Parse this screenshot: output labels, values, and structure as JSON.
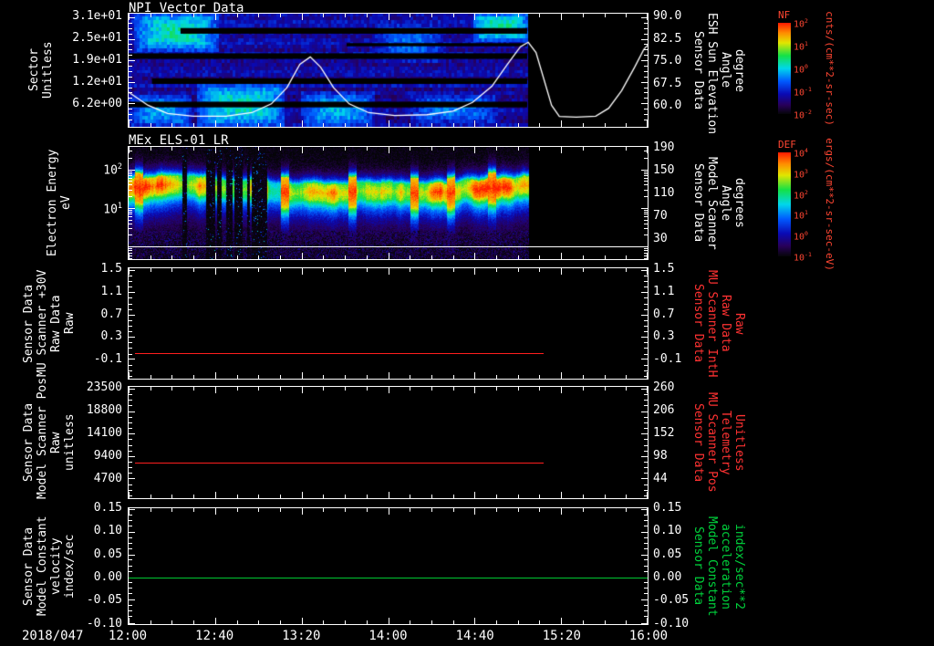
{
  "window_bg": "#000000",
  "date_label": "2018/047",
  "x_axis": {
    "tick_labels": [
      "12:00",
      "12:40",
      "13:20",
      "14:00",
      "14:40",
      "15:20",
      "16:00"
    ]
  },
  "colorbar_gradient": [
    [
      "#050508",
      0
    ],
    [
      "#28005a",
      0.1
    ],
    [
      "#0a0ab4",
      0.22
    ],
    [
      "#005aff",
      0.36
    ],
    [
      "#00d7eb",
      0.5
    ],
    [
      "#14e146",
      0.64
    ],
    [
      "#e1e600",
      0.78
    ],
    [
      "#ff8c00",
      0.89
    ],
    [
      "#ff1900",
      1
    ]
  ],
  "colorbars": [
    {
      "title": "NF",
      "tick_labels": [
        "10^2",
        "10^1",
        "10^0",
        "10^-1",
        "10^-2"
      ],
      "unit": "cnts/(cm**2-sr-sec)",
      "color": "#ff4632"
    },
    {
      "title": "DEF",
      "tick_labels": [
        "10^4",
        "10^3",
        "10^2",
        "10^1",
        "10^0",
        "10^-1"
      ],
      "unit": "ergs/(cm**2-sr-sec-eV)",
      "color": "#ff4632"
    }
  ],
  "chart_data": [
    {
      "type": "heatmap",
      "title": "NPI Vector Data",
      "left_label_lines": [
        "Sector",
        "Unitless"
      ],
      "left_ticks": [
        {
          "label": "3.1e+01",
          "pos": 0.032
        },
        {
          "label": "2.5e+01",
          "pos": 0.222
        },
        {
          "label": "1.9e+01",
          "pos": 0.413
        },
        {
          "label": "1.2e+01",
          "pos": 0.603
        },
        {
          "label": "6.2e+00",
          "pos": 0.794
        }
      ],
      "right_label_lines": [
        "Sensor Data",
        "ESH Sun Elevation",
        "Angle",
        "degree"
      ],
      "right_label_color": "#ffffff",
      "right_ticks": [
        {
          "label": "90.0",
          "pos": 0.032,
          "value": 90
        },
        {
          "label": "82.5",
          "pos": 0.227,
          "value": 82.5
        },
        {
          "label": "75.0",
          "pos": 0.421,
          "value": 75
        },
        {
          "label": "67.5",
          "pos": 0.616,
          "value": 67.5
        },
        {
          "label": "60.0",
          "pos": 0.81,
          "value": 60
        }
      ],
      "x_span_hours": [
        0,
        4
      ],
      "data_end_frac": 0.768,
      "units": "cnts/(cm**2-sr-sec)",
      "overlay_line": {
        "name": "ESH Sun Elevation Angle",
        "color": "#ffffff",
        "units": "degree",
        "points_time_value": [
          [
            0,
            64.5
          ],
          [
            0.15,
            60
          ],
          [
            0.3,
            57.2
          ],
          [
            0.5,
            56.3
          ],
          [
            0.75,
            56.3
          ],
          [
            0.95,
            57.5
          ],
          [
            1.1,
            60.5
          ],
          [
            1.22,
            66
          ],
          [
            1.32,
            74
          ],
          [
            1.4,
            76.5
          ],
          [
            1.48,
            73
          ],
          [
            1.58,
            66
          ],
          [
            1.7,
            60.5
          ],
          [
            1.85,
            57.5
          ],
          [
            2.05,
            56.5
          ],
          [
            2.3,
            56.8
          ],
          [
            2.5,
            58
          ],
          [
            2.65,
            61
          ],
          [
            2.8,
            66.5
          ],
          [
            2.92,
            74
          ],
          [
            3.02,
            80
          ],
          [
            3.08,
            81.5
          ],
          [
            3.14,
            78
          ],
          [
            3.2,
            69
          ],
          [
            3.26,
            60
          ],
          [
            3.32,
            56.2
          ],
          [
            3.45,
            56
          ],
          [
            3.6,
            56.3
          ],
          [
            3.7,
            59
          ],
          [
            3.8,
            65
          ],
          [
            3.9,
            73
          ],
          [
            3.97,
            79
          ],
          [
            4,
            80.5
          ]
        ]
      },
      "features": {
        "black_rows": [
          {
            "y": 0.127,
            "h": 0.05,
            "x0": 0.1,
            "x1": 0.768
          },
          {
            "y": 0.35,
            "h": 0.05,
            "x0": 0,
            "x1": 0.768
          },
          {
            "y": 0.571,
            "h": 0.05,
            "x0": 0.045,
            "x1": 0.768
          },
          {
            "y": 0.778,
            "h": 0.05,
            "x0": 0,
            "x1": 0.768
          },
          {
            "y": 0.26,
            "h": 0.028,
            "x0": 0.42,
            "x1": 0.768
          }
        ],
        "patches": [
          {
            "x0": 0.01,
            "x1": 0.17,
            "y0": 0,
            "y1": 0.33,
            "v": 0.56
          },
          {
            "x0": 0.13,
            "x1": 0.3,
            "y0": 0.62,
            "y1": 1,
            "v": 0.54
          },
          {
            "x0": 0.33,
            "x1": 0.47,
            "y0": 0.7,
            "y1": 1,
            "v": 0.47
          },
          {
            "x0": 0.66,
            "x1": 0.768,
            "y0": 0,
            "y1": 0.24,
            "v": 0.58
          },
          {
            "x0": 0.47,
            "x1": 0.61,
            "y0": 0.08,
            "y1": 0.45,
            "v": 0.38
          },
          {
            "x0": 0,
            "x1": 0.12,
            "y0": 0.72,
            "y1": 1,
            "v": 0.45
          },
          {
            "x0": 0.54,
            "x1": 0.71,
            "y0": 0.72,
            "y1": 0.97,
            "v": 0.4
          }
        ]
      }
    },
    {
      "type": "heatmap",
      "title": "MEx ELS-01 LR",
      "log": true,
      "left_label_lines": [
        "Electron Energy",
        "eV"
      ],
      "left_ticks": [
        {
          "label": "10^2",
          "pos": 0.2,
          "value": 100
        },
        {
          "label": "10^1",
          "pos": 0.544,
          "value": 10
        }
      ],
      "right_label_lines": [
        "Sensor Data",
        "Model Scanner",
        "Angle",
        "degrees"
      ],
      "right_label_color": "#ffffff",
      "right_ticks": [
        {
          "label": "190",
          "pos": 0.016,
          "value": 190
        },
        {
          "label": "150",
          "pos": 0.216,
          "value": 150
        },
        {
          "label": "110",
          "pos": 0.416,
          "value": 110
        },
        {
          "label": "70",
          "pos": 0.616,
          "value": 70
        },
        {
          "label": "30",
          "pos": 0.816,
          "value": 30
        }
      ],
      "x_span_hours": [
        0,
        4
      ],
      "data_end_frac": 0.772,
      "units": "ergs/(cm**2-sr-sec-eV)",
      "overlay_line": {
        "name": "Model Scanner Angle",
        "color": "#ffffff",
        "value": 16,
        "full_width": true
      },
      "features": {
        "band_center": 0.37,
        "band_halfwidth": 0.075,
        "gaps": [
          [
            0.099,
            0.112
          ],
          [
            0.148,
            0.178
          ],
          [
            0.188,
            0.218
          ],
          [
            0.228,
            0.268
          ]
        ],
        "spikes": [
          0.02,
          0.3,
          0.43,
          0.55,
          0.62,
          0.7
        ],
        "dip": [
          0.268,
          0.305
        ]
      }
    },
    {
      "type": "line",
      "left_label_lines": [
        "Sensor Data",
        "MU Scanner +30V",
        "Raw Data",
        "Raw"
      ],
      "left_ticks": [
        {
          "label": "1.5",
          "pos": 0.016,
          "value": 1.5
        },
        {
          "label": "1.1",
          "pos": 0.218,
          "value": 1.1
        },
        {
          "label": "0.7",
          "pos": 0.419,
          "value": 0.7
        },
        {
          "label": "0.3",
          "pos": 0.62,
          "value": 0.3
        },
        {
          "label": "-0.1",
          "pos": 0.821,
          "value": -0.1
        }
      ],
      "right_label_lines": [
        "Sensor Data",
        "MU Scanner IntH",
        "Raw Data",
        "Raw"
      ],
      "right_label_color": "#ff3232",
      "right_ticks": [
        {
          "label": "1.5",
          "pos": 0.016
        },
        {
          "label": "1.1",
          "pos": 0.218
        },
        {
          "label": "0.7",
          "pos": 0.419
        },
        {
          "label": "0.3",
          "pos": 0.62
        },
        {
          "label": "-0.1",
          "pos": 0.821
        }
      ],
      "series": [
        {
          "name": "MU Scanner +30V Raw Data",
          "color": "#ff1e1e",
          "constant_value": 0.0,
          "x0": 0.012,
          "x1": 0.8
        }
      ]
    },
    {
      "type": "line",
      "left_label_lines": [
        "Sensor Data",
        "Model Scanner Pos",
        "Raw",
        "unitless"
      ],
      "left_ticks": [
        {
          "label": "23500",
          "pos": 0.016,
          "value": 23500
        },
        {
          "label": "18800",
          "pos": 0.218,
          "value": 18800
        },
        {
          "label": "14100",
          "pos": 0.419,
          "value": 14100
        },
        {
          "label": "9400",
          "pos": 0.62,
          "value": 9400
        },
        {
          "label": "4700",
          "pos": 0.821,
          "value": 4700
        }
      ],
      "right_label_lines": [
        "Sensor Data",
        "MU Scanner Pos",
        "Telemetry",
        "Unitless"
      ],
      "right_label_color": "#ff3232",
      "right_ticks": [
        {
          "label": "260",
          "pos": 0.016
        },
        {
          "label": "206",
          "pos": 0.218
        },
        {
          "label": "152",
          "pos": 0.419
        },
        {
          "label": "98",
          "pos": 0.62
        },
        {
          "label": "44",
          "pos": 0.821
        }
      ],
      "series": [
        {
          "name": "Model Scanner Pos Raw",
          "color": "#ff1e1e",
          "constant_value": 8000,
          "x0": 0.012,
          "x1": 0.8
        }
      ]
    },
    {
      "type": "line",
      "left_label_lines": [
        "Sensor Data",
        "Model Constant",
        "velocity",
        "index/sec"
      ],
      "left_ticks": [
        {
          "label": "0.15",
          "pos": 0.008,
          "value": 0.15
        },
        {
          "label": "0.10",
          "pos": 0.202,
          "value": 0.1
        },
        {
          "label": "0.05",
          "pos": 0.403,
          "value": 0.05
        },
        {
          "label": "0.00",
          "pos": 0.597,
          "value": 0.0
        },
        {
          "label": "-0.05",
          "pos": 0.791,
          "value": -0.05
        },
        {
          "label": "-0.10",
          "pos": 0.992,
          "value": -0.1
        }
      ],
      "right_label_lines": [
        "Sensor Data",
        "Model Constant",
        "acceleration",
        "index/sec**2"
      ],
      "right_label_color": "#00d23c",
      "right_ticks": [
        {
          "label": "0.15",
          "pos": 0.008
        },
        {
          "label": "0.10",
          "pos": 0.202
        },
        {
          "label": "0.05",
          "pos": 0.403
        },
        {
          "label": "0.00",
          "pos": 0.597
        },
        {
          "label": "-0.05",
          "pos": 0.791
        },
        {
          "label": "-0.10",
          "pos": 0.992
        }
      ],
      "series": [
        {
          "name": "Model Constant velocity",
          "color": "#00c832",
          "constant_value": 0.0,
          "x0": 0.0,
          "x1": 1.0
        }
      ]
    }
  ]
}
